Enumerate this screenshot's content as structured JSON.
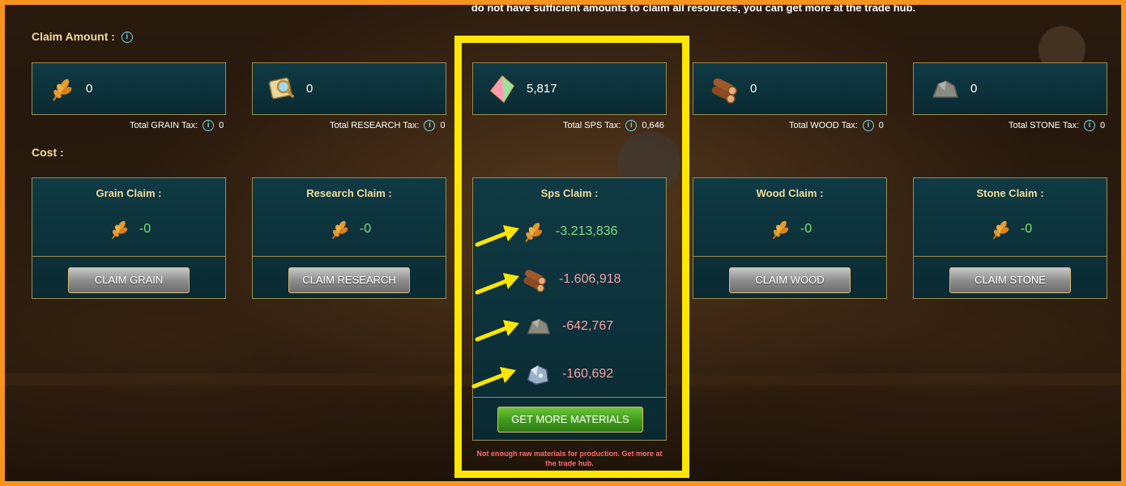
{
  "notice": "do not have sufficient amounts to claim all resources, you can get more at the trade hub.",
  "claim_amount_label": "Claim Amount :",
  "cost_label": "Cost :",
  "info_glyph": "i",
  "resources": [
    {
      "key": "grain",
      "icon": "wheat-icon",
      "amount": "0",
      "tax_label": "Total GRAIN Tax:",
      "tax_value": "0"
    },
    {
      "key": "research",
      "icon": "research-scroll-icon",
      "amount": "0",
      "tax_label": "Total RESEARCH Tax:",
      "tax_value": "0"
    },
    {
      "key": "sps",
      "icon": "sps-crystal-icon",
      "amount": "5,817",
      "tax_label": "Total SPS Tax:",
      "tax_value": "0,646"
    },
    {
      "key": "wood",
      "icon": "wood-logs-icon",
      "amount": "0",
      "tax_label": "Total WOOD Tax:",
      "tax_value": "0"
    },
    {
      "key": "stone",
      "icon": "stone-icon",
      "amount": "0",
      "tax_label": "Total STONE Tax:",
      "tax_value": "0"
    }
  ],
  "cost_cards": {
    "grain": {
      "title": "Grain Claim :",
      "value": "-0",
      "button": "CLAIM GRAIN"
    },
    "research": {
      "title": "Research Claim :",
      "value": "-0",
      "button": "CLAIM RESEARCH"
    },
    "wood": {
      "title": "Wood Claim :",
      "value": "-0",
      "button": "CLAIM WOOD"
    },
    "stone": {
      "title": "Stone Claim :",
      "value": "-0",
      "button": "CLAIM STONE"
    }
  },
  "sps_card": {
    "title": "Sps Claim :",
    "grain_cost": "-3.213,836",
    "wood_cost": "-1.606,918",
    "stone_cost": "-642,767",
    "iron_cost": "-160,692",
    "button": "GET MORE MATERIALS",
    "warning": "Not enough raw materials for production. Get more at the trade hub."
  },
  "colors": {
    "highlight": "#ffe600",
    "border_frame": "#f7941d",
    "positive": "#7ee07a",
    "negative": "#ff9e9e"
  }
}
